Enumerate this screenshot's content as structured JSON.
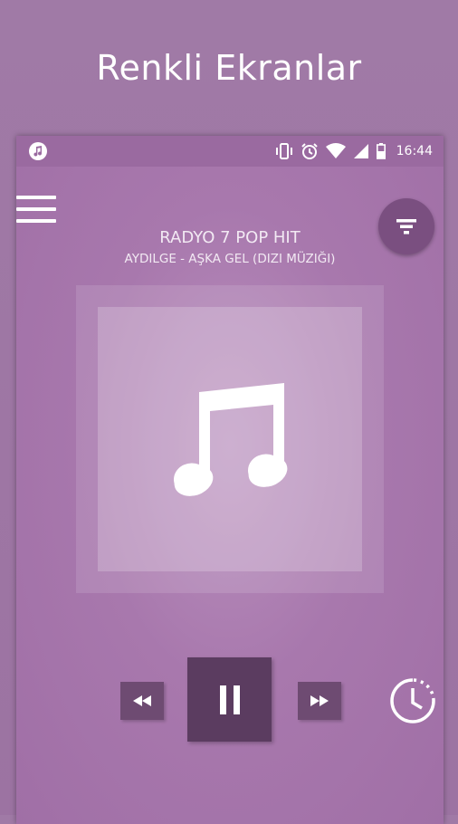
{
  "banner": {
    "title": "Renkli Ekranlar"
  },
  "statusbar": {
    "time": "16:44",
    "icons": [
      "music-note-icon",
      "vibrate-icon",
      "alarm-icon",
      "wifi-icon",
      "signal-icon",
      "battery-icon"
    ]
  },
  "player": {
    "station_name": "RADYO 7 POP HIT",
    "track_title": "AYDILGE - AŞKA GEL (DIZI MÜZIĞI)",
    "state": "playing"
  },
  "toolbar": {
    "menu_icon": "hamburger-menu-icon",
    "filter_icon": "filter-icon"
  },
  "controls": {
    "prev_icon": "rewind-icon",
    "play_icon": "pause-icon",
    "next_icon": "fast-forward-icon",
    "timer_icon": "sleep-timer-icon"
  },
  "colors": {
    "background": "#a07aa6",
    "panel": "#a878ad",
    "button_dark": "#5b3c60",
    "button_mid": "#6e4b72",
    "text": "#ffffff"
  }
}
